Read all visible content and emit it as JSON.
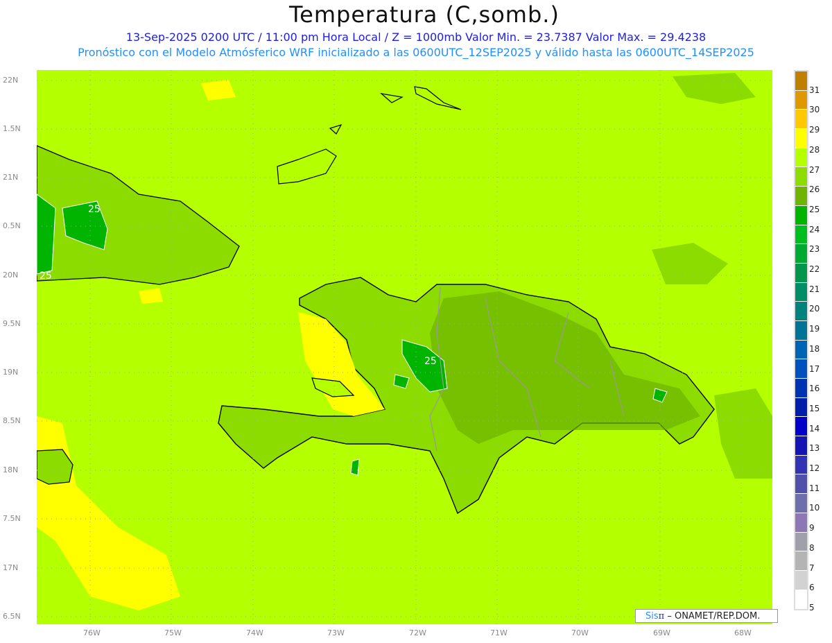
{
  "title": "Temperatura (C,somb.)",
  "subtitle1": "13-Sep-2025 0200 UTC / 11:00 pm Hora Local / Z = 1000mb   Valor Min. = 23.7387   Valor Max. = 29.4238",
  "subtitle2": "Pronóstico con el Modelo Atmósferico WRF inicializado a las 0600UTC_12SEP2025 y válido hasta las  0600UTC_14SEP2025",
  "lon_labels": [
    "76W",
    "75W",
    "74W",
    "73W",
    "72W",
    "71W",
    "70W",
    "69W",
    "68W"
  ],
  "lat_labels": [
    "22N",
    "1.5N",
    "21N",
    "0.5N",
    "20N",
    "9.5N",
    "19N",
    "8.5N",
    "18N",
    "7.5N",
    "17N",
    "6.5N"
  ],
  "contour_labels": [
    "25",
    "25",
    "25"
  ],
  "colorbar": {
    "labels": [
      "31",
      "30",
      "29",
      "28",
      "27",
      "26",
      "25",
      "24",
      "23",
      "22",
      "21",
      "20",
      "19",
      "18",
      "17",
      "16",
      "15",
      "14",
      "13",
      "12",
      "11",
      "10",
      "9",
      "8",
      "7",
      "6",
      "5"
    ],
    "colors": [
      "#c07f00",
      "#e09800",
      "#ffc800",
      "#ffff00",
      "#b4ff00",
      "#8cdc00",
      "#6eb400",
      "#00b400",
      "#00be1e",
      "#00aa32",
      "#00964b",
      "#008c64",
      "#00827d",
      "#007396",
      "#0064b4",
      "#0050be",
      "#0032b4",
      "#001eaa",
      "#0000c8",
      "#1414b4",
      "#3232b4",
      "#5050aa",
      "#6e6eaa",
      "#8c78b4",
      "#a0a0aa",
      "#b4b4b4",
      "#d2d2d2",
      "#ffffff"
    ]
  },
  "credit": {
    "brand_a": "Sis",
    "brand_b": "π",
    "rest": "– ONAMET/REP.DOM."
  }
}
